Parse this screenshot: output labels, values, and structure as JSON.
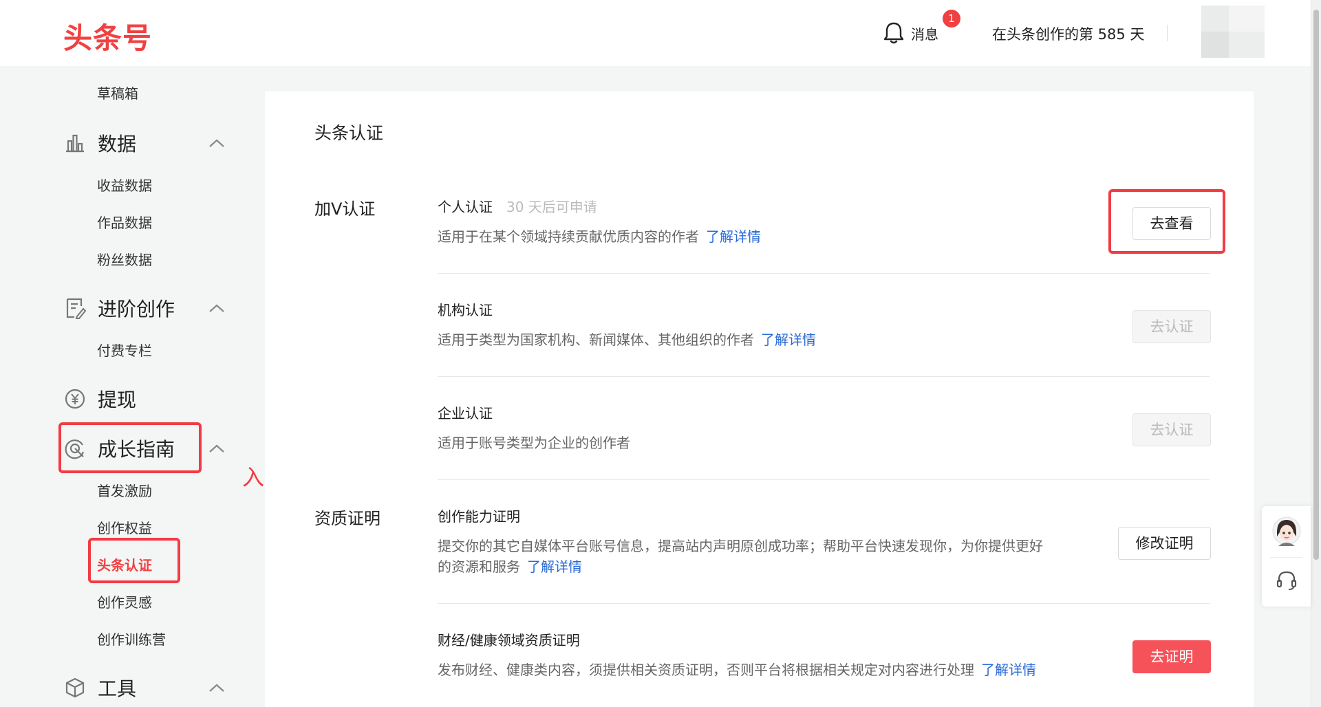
{
  "header": {
    "logo": "头条号",
    "messages_label": "消息",
    "messages_badge": "1",
    "days_text": "在头条创作的第 585 天"
  },
  "sidebar": {
    "drafts": "草稿箱",
    "data": {
      "label": "数据",
      "items": [
        "收益数据",
        "作品数据",
        "粉丝数据"
      ]
    },
    "advanced": {
      "label": "进阶创作",
      "items": [
        "付费专栏"
      ]
    },
    "withdraw": {
      "label": "提现"
    },
    "growth": {
      "label": "成长指南",
      "items": [
        "首发激励",
        "创作权益",
        "头条认证",
        "创作灵感",
        "创作训练营"
      ],
      "active": "头条认证"
    },
    "tools": {
      "label": "工具"
    }
  },
  "annotation": "入口一",
  "main": {
    "title": "头条认证",
    "vcert": {
      "label": "加V认证",
      "items": [
        {
          "name": "个人认证",
          "hint": "30 天后可申请",
          "desc": "适用于在某个领域持续贡献优质内容的作者",
          "link": "了解详情",
          "button": "去查看",
          "button_state": "normal"
        },
        {
          "name": "机构认证",
          "desc": "适用于类型为国家机构、新闻媒体、其他组织的作者",
          "link": "了解详情",
          "button": "去认证",
          "button_state": "disabled"
        },
        {
          "name": "企业认证",
          "desc": "适用于账号类型为企业的创作者",
          "button": "去认证",
          "button_state": "disabled"
        }
      ]
    },
    "qualification": {
      "label": "资质证明",
      "items": [
        {
          "name": "创作能力证明",
          "desc_line1": "提交你的其它自媒体平台账号信息，提高站内声明原创成功率；帮助平台快速发现你，为你提供更好",
          "desc_line2": "的资源和服务",
          "link": "了解详情",
          "button": "修改证明",
          "button_state": "normal"
        },
        {
          "name": "财经/健康领域资质证明",
          "desc": "发布财经、健康类内容，须提供相关资质证明，否则平台将根据相关规定对内容进行处理",
          "link": "了解详情",
          "button": "去证明",
          "button_state": "primary"
        }
      ]
    }
  },
  "colors": {
    "brand_red": "#f04142",
    "annotation_red": "#f23b43",
    "link_blue": "#2a6bd8"
  }
}
